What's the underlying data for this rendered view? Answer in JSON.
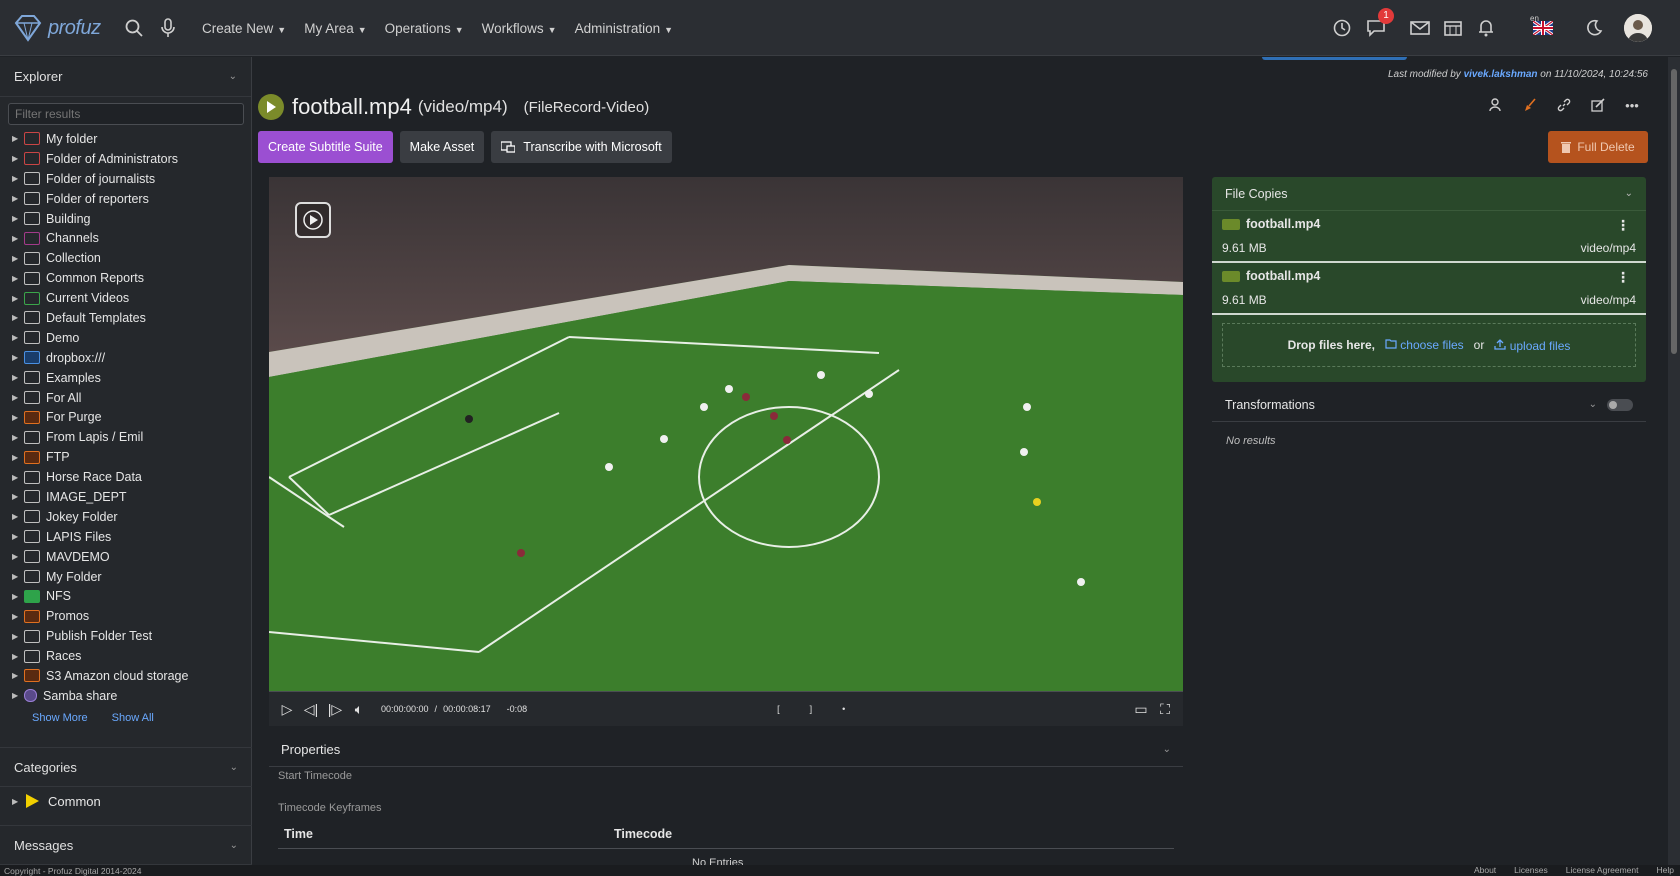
{
  "app": {
    "logo_text": "profuz"
  },
  "nav": {
    "items": [
      "Create New",
      "My Area",
      "Operations",
      "Workflows",
      "Administration"
    ],
    "chat_badge": "1",
    "lang": "en"
  },
  "sidebar": {
    "title": "Explorer",
    "filter_placeholder": "Filter results",
    "items": [
      "My folder",
      "Folder of Administrators",
      "Folder of journalists",
      "Folder of reporters",
      "Building",
      "Channels",
      "Collection",
      "Common Reports",
      "Current Videos",
      "Default Templates",
      "Demo",
      "dropbox:///",
      "Examples",
      "For All",
      "For Purge",
      "From Lapis / Emil",
      "FTP",
      "Horse Race Data",
      "IMAGE_DEPT",
      "Jokey Folder",
      "LAPIS Files",
      "MAVDEMO",
      "My Folder",
      "NFS",
      "Promos",
      "Publish Folder Test",
      "Races",
      "S3 Amazon cloud storage",
      "Samba share"
    ],
    "show_more": "Show More",
    "show_all": "Show All",
    "categories_title": "Categories",
    "category_item": "Common",
    "messages_title": "Messages"
  },
  "header": {
    "last_modified_prefix": "Last modified by",
    "last_modified_user": "vivek.lakshman",
    "last_modified_suffix": "on 11/10/2024, 10:24:56",
    "file_name": "football.mp4",
    "file_mime": "(video/mp4)",
    "file_type": "(FileRecord-Video)"
  },
  "buttons": {
    "create_subtitle": "Create Subtitle Suite",
    "make_asset": "Make Asset",
    "transcribe": "Transcribe with Microsoft",
    "full_delete": "Full Delete"
  },
  "player": {
    "current_time": "00:00:00:00",
    "separator": "/",
    "duration": "00:00:08:17",
    "offset": "-0:08",
    "progress": 0.0
  },
  "properties": {
    "title": "Properties",
    "start_timecode_label": "Start Timecode",
    "keyframes_label": "Timecode Keyframes",
    "col_time": "Time",
    "col_timecode": "Timecode",
    "empty": "No Entries"
  },
  "file_copies": {
    "title": "File Copies",
    "copies": [
      {
        "name": "football.mp4",
        "size": "9.61 MB",
        "mime": "video/mp4"
      },
      {
        "name": "football.mp4",
        "size": "9.61 MB",
        "mime": "video/mp4"
      }
    ],
    "drop_text": "Drop files here,",
    "choose": "choose files",
    "or": "or",
    "upload": "upload files"
  },
  "transformations": {
    "title": "Transformations",
    "empty": "No results"
  },
  "footer": {
    "copyright": "Copyright - Profuz Digital 2014-2024",
    "links": [
      "About",
      "Licenses",
      "License Agreement",
      "Help"
    ]
  },
  "colors": {
    "primary_button": "#9b4fd2",
    "danger_button": "#b5531e",
    "file_copies_bg": "#29482a",
    "link": "#6aa9ff"
  }
}
